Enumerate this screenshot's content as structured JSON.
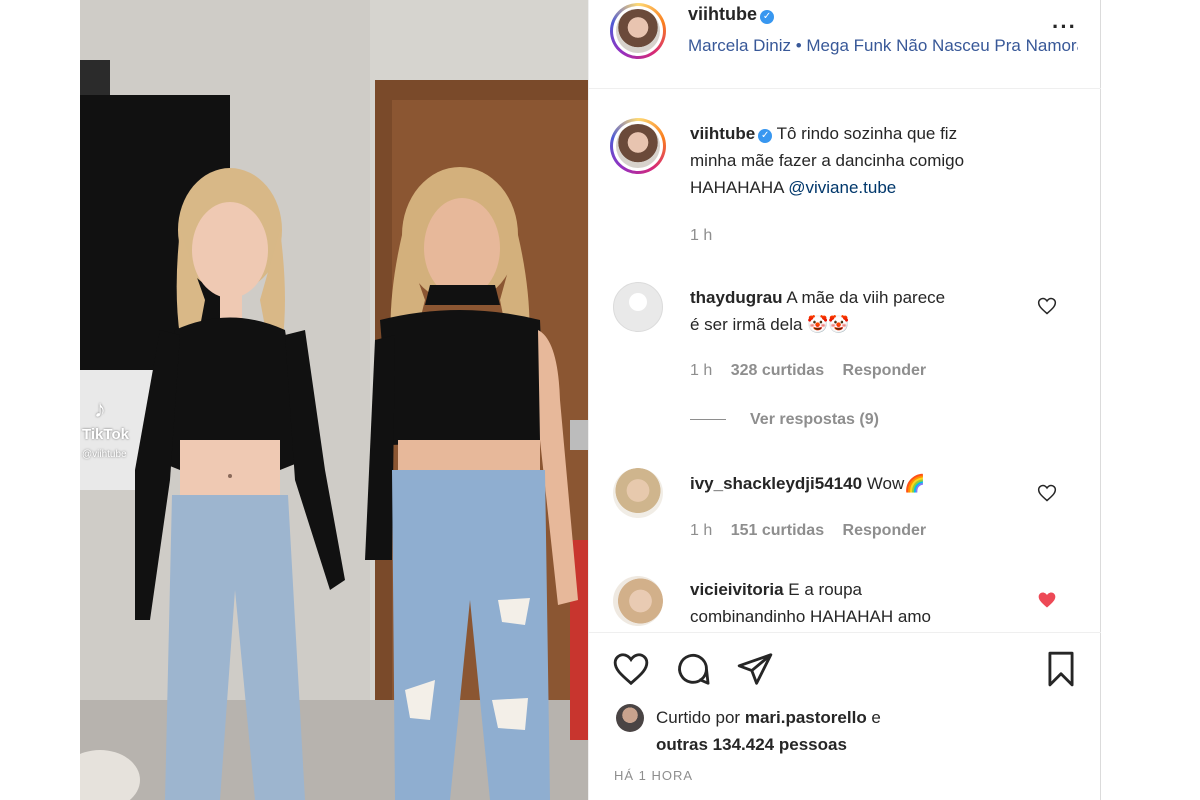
{
  "post": {
    "username": "viihtube",
    "music": "Marcela Diniz • Mega Funk Não Nasceu Pra Namorar",
    "more_icon": "more-horizontal-icon"
  },
  "caption": {
    "username": "viihtube",
    "text_line1": "Tô rindo sozinha que fiz",
    "text_line2": "minha mãe fazer a dancinha comigo",
    "text_line3": "HAHAHAHA ",
    "mention": "@viviane.tube",
    "time": "1 h"
  },
  "comments": [
    {
      "username": "thaydugrau",
      "text_line1": "A mãe da viih parece",
      "text_line2": "é ser irmã dela 🤡🤡",
      "time": "1 h",
      "likes": "328 curtidas",
      "reply_label": "Responder",
      "liked": false
    },
    {
      "username": "ivy_shackleydji54140",
      "text_line1": "Wow🌈",
      "time": "1 h",
      "likes": "151 curtidas",
      "reply_label": "Responder",
      "liked": false
    },
    {
      "username": "vicieivitoria",
      "text_line1": "E a roupa",
      "text_line2": "combinandinho HAHAHAH amo",
      "liked": true
    }
  ],
  "view_replies": "Ver respostas (9)",
  "likes_block": {
    "prefix": "Curtido por ",
    "liker": "mari.pastorello",
    "mid": " e",
    "others": "outras 134.424 pessoas"
  },
  "timestamp": "HÁ 1 HORA",
  "watermark": {
    "brand": "TikTok",
    "user": "@viihtube"
  },
  "colors": {
    "link": "#00376b",
    "verified": "#3897f0",
    "liked_heart": "#ed4956",
    "muted": "#8e8e8e"
  }
}
